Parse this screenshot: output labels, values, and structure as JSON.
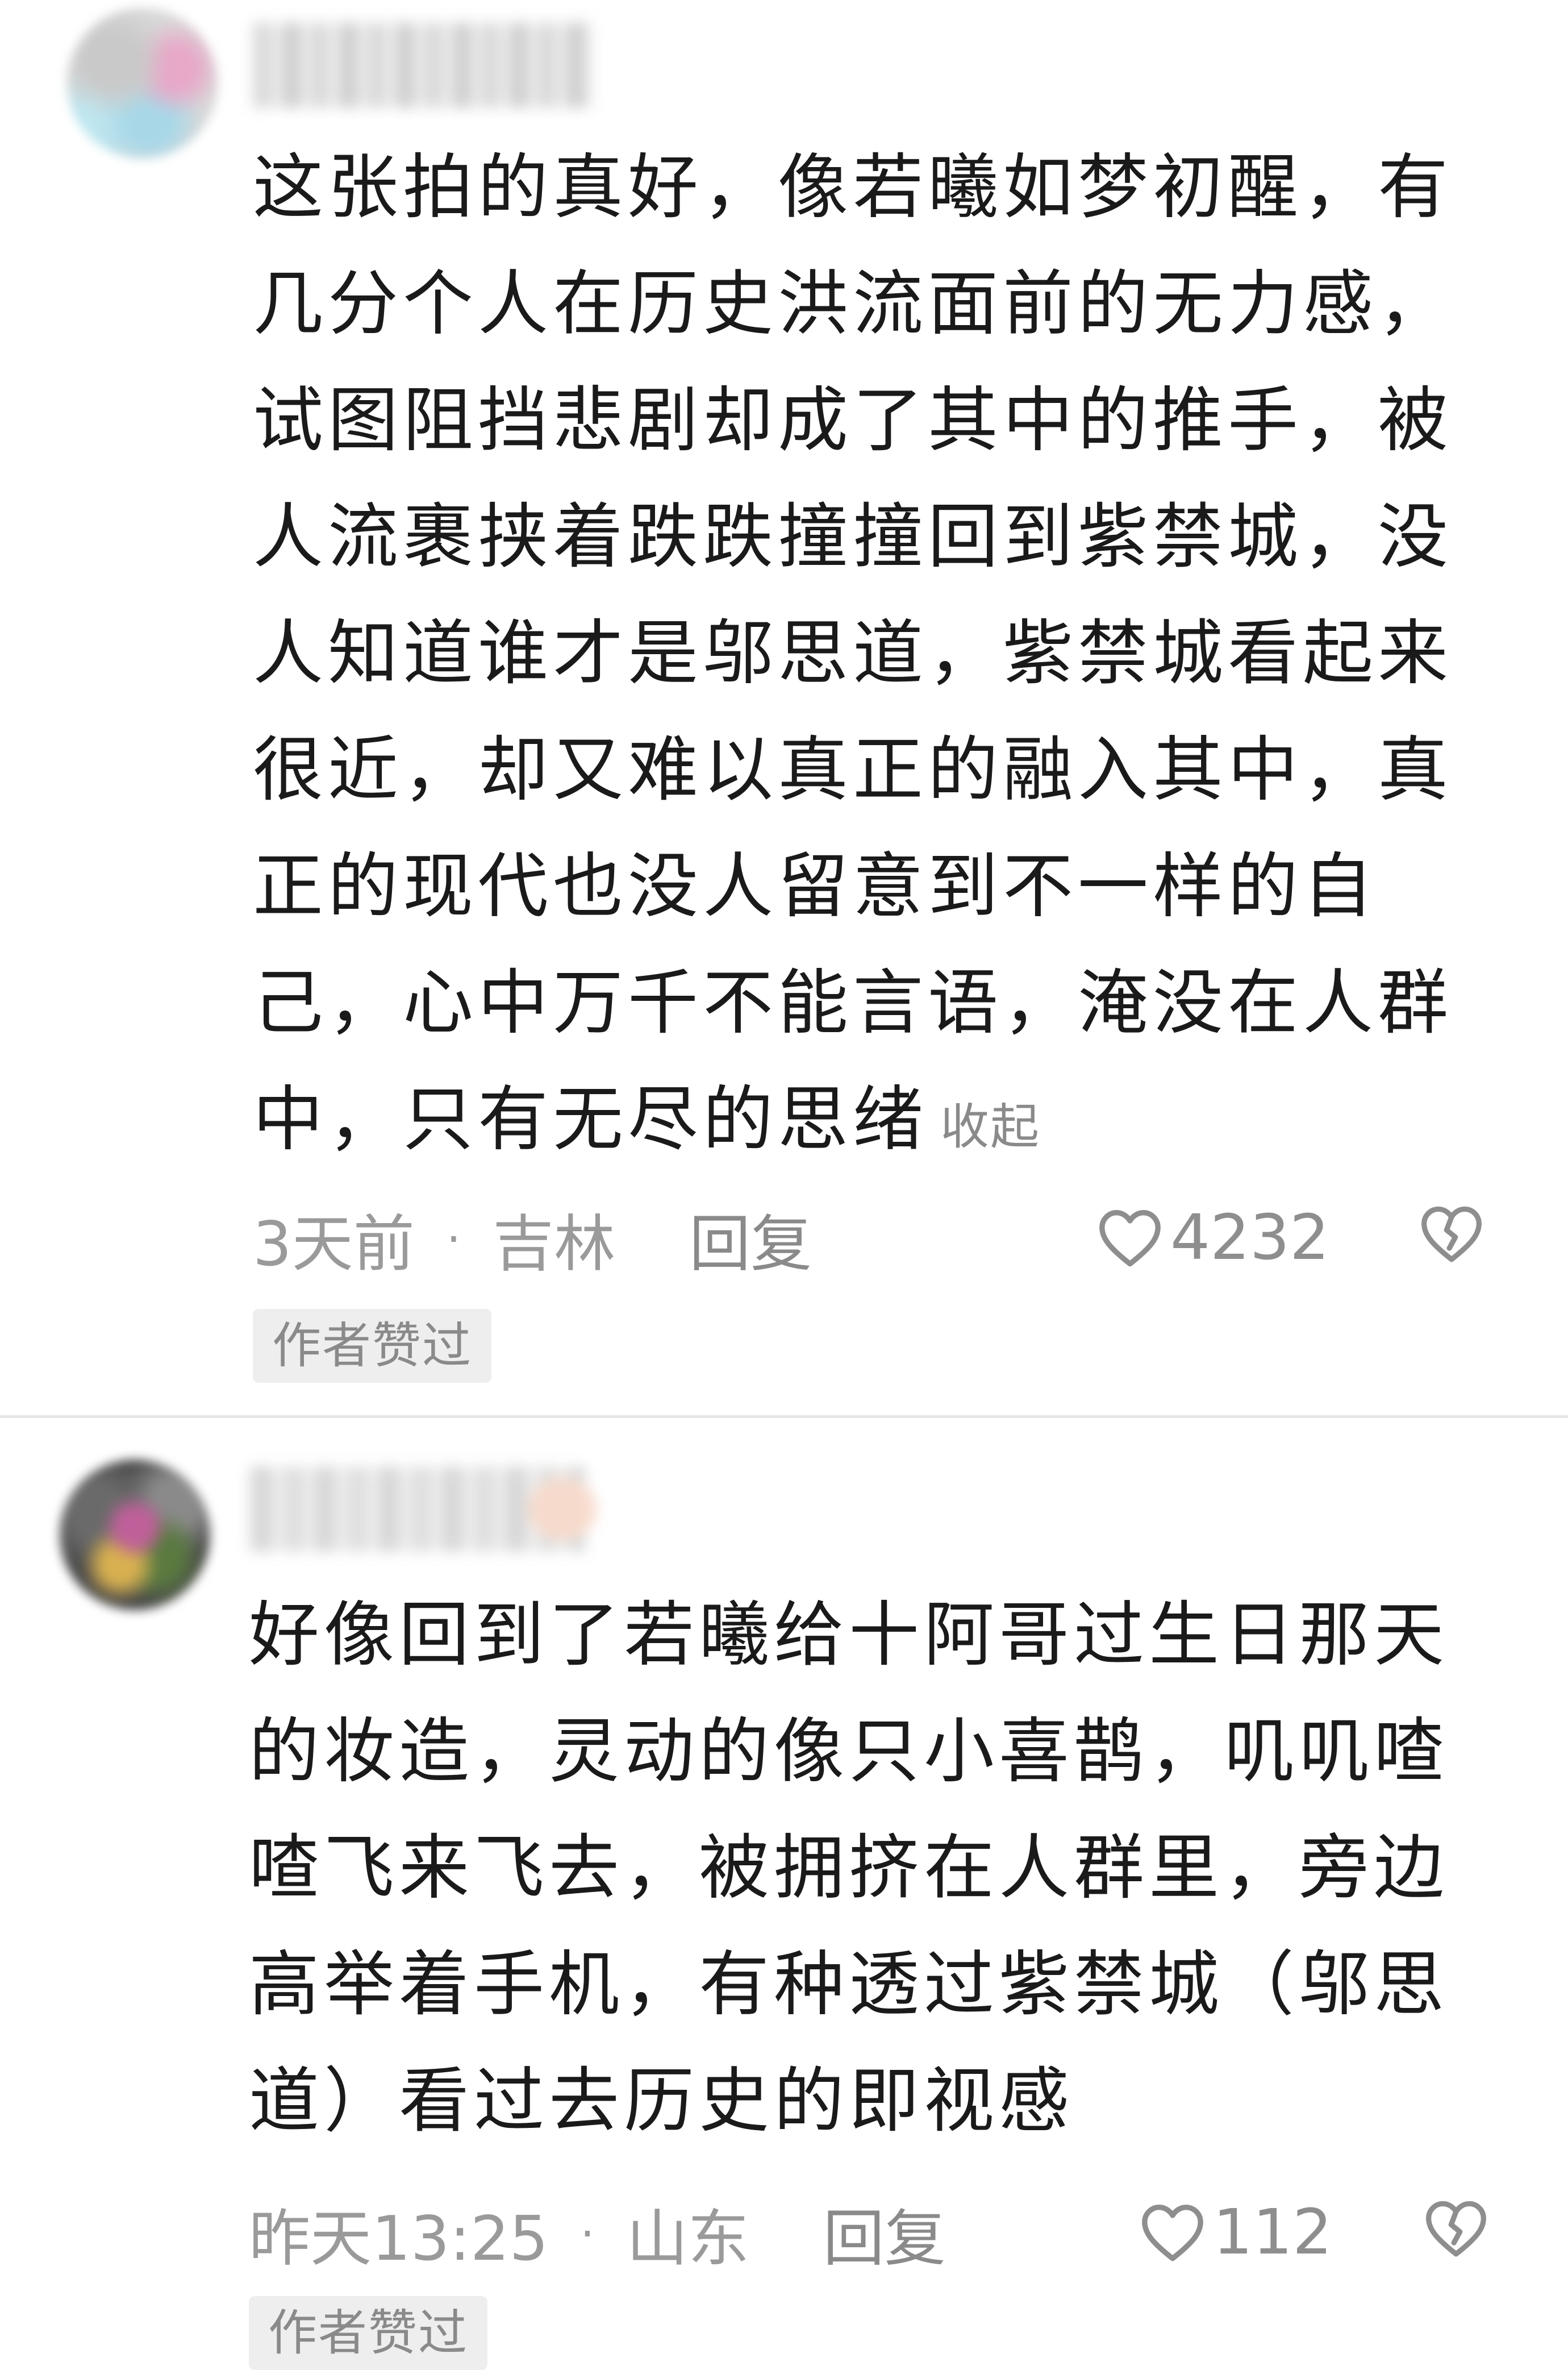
{
  "comments": [
    {
      "text": "这张拍的真好，像若曦如梦初醒，有几分个人在历史洪流面前的无力感，试图阻挡悲剧却成了其中的推手，被人流裹挟着跌跌撞撞回到紫禁城，没人知道谁才是邬思道，紫禁城看起来很近，却又难以真正的融入其中，真正的现代也没人留意到不一样的自己，心中万千不能言语，淹没在人群中，只有无尽的思绪",
      "collapse_label": "收起",
      "time": "3天前",
      "separator": "·",
      "location": "吉林",
      "reply_label": "回复",
      "likes": "4232",
      "badge": "作者赞过"
    },
    {
      "text": "好像回到了若曦给十阿哥过生日那天的妆造，灵动的像只小喜鹊，叽叽喳喳飞来飞去，被拥挤在人群里，旁边高举着手机，有种透过紫禁城（邬思道）看过去历史的即视感",
      "time": "昨天13:25",
      "separator": "·",
      "location": "山东",
      "reply_label": "回复",
      "likes": "112",
      "badge": "作者赞过"
    }
  ],
  "icons": {
    "like": "heart-outline-icon",
    "dislike": "broken-heart-icon"
  },
  "colors": {
    "text": "#1a1a1a",
    "muted": "#9a9a9a",
    "badge_bg": "#eeeeee",
    "divider": "#e6e6e6"
  }
}
